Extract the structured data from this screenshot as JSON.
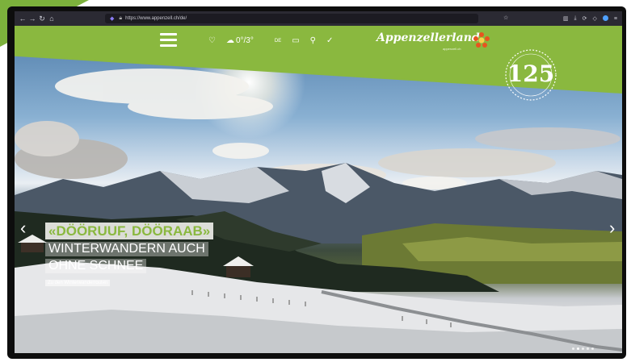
{
  "browser": {
    "url": "https://www.appenzell.ch/de/",
    "nav_icons": [
      "back-arrow-icon",
      "forward-arrow-icon",
      "reload-icon",
      "home-icon"
    ],
    "right_icons": [
      "bookmark-icon",
      "library-icon",
      "download-icon",
      "extensions-icon",
      "profile-icon",
      "menu-icon"
    ]
  },
  "header": {
    "logo_text": "Appenzellerland.",
    "logo_sub": "appenzell.ch",
    "weather_temp": "0°/3°",
    "language": "DE",
    "badge_number": "125",
    "colors": {
      "brand_green": "#8ab83f",
      "badge_white": "#ffffff"
    }
  },
  "slide": {
    "headline": "«DÖÖRUUF, DÖÖRAAB»",
    "subline_1": "WINTERWANDERN AUCH",
    "subline_2": "OHNE SCHNEE",
    "link": "Zu den Winterwanderrouten"
  }
}
